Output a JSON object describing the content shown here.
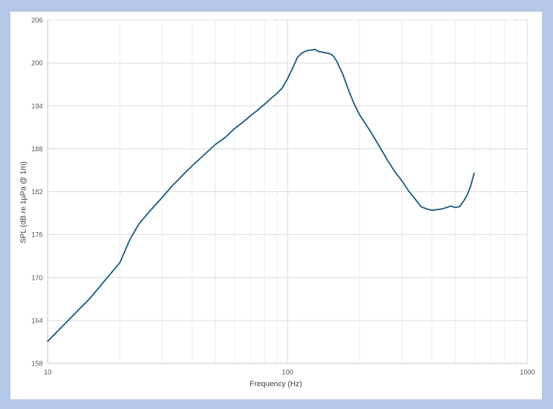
{
  "chart_data": {
    "type": "line",
    "title": "",
    "xlabel": "Frequency (Hz)",
    "ylabel": "SPL (dB re 1µPa @ 1m)",
    "x_scale": "log",
    "xlim": [
      10,
      1000
    ],
    "ylim": [
      158,
      206
    ],
    "x_ticks": [
      10,
      100,
      1000
    ],
    "x_tick_labels": [
      "10",
      "100",
      "1000"
    ],
    "y_ticks": [
      158,
      164,
      170,
      176,
      182,
      188,
      194,
      200,
      206
    ],
    "y_tick_labels": [
      "158",
      "164",
      "170",
      "176",
      "182",
      "188",
      "194",
      "200",
      "206"
    ],
    "grid": true,
    "legend": "none",
    "colors": {
      "line": "#1f5f80",
      "grid": "#d9d9d9",
      "axis": "#bfbfbf",
      "background": "#b4c7e7"
    },
    "series": [
      {
        "x": [
          10,
          15,
          20,
          22,
          24,
          27,
          30,
          33,
          37,
          40,
          45,
          50,
          55,
          60,
          65,
          70,
          75,
          80,
          85,
          90,
          95,
          100,
          105,
          110,
          115,
          120,
          125,
          130,
          135,
          140,
          145,
          150,
          155,
          160,
          170,
          180,
          190,
          200,
          220,
          240,
          260,
          280,
          300,
          320,
          340,
          360,
          380,
          400,
          420,
          440,
          460,
          480,
          500,
          520,
          540,
          560,
          580,
          600
        ],
        "y": [
          161.1,
          167.1,
          172.1,
          175.3,
          177.5,
          179.5,
          181.2,
          182.8,
          184.5,
          185.6,
          187.2,
          188.6,
          189.6,
          190.8,
          191.7,
          192.6,
          193.4,
          194.2,
          195.0,
          195.7,
          196.5,
          197.8,
          199.3,
          200.8,
          201.4,
          201.7,
          201.8,
          201.9,
          201.6,
          201.5,
          201.4,
          201.3,
          201.0,
          200.3,
          198.4,
          196.1,
          194.2,
          192.7,
          190.6,
          188.5,
          186.5,
          184.8,
          183.5,
          182.1,
          181.0,
          179.9,
          179.6,
          179.4,
          179.5,
          179.6,
          179.8,
          180.0,
          179.8,
          179.9,
          180.6,
          181.5,
          182.8,
          184.6
        ]
      }
    ]
  }
}
